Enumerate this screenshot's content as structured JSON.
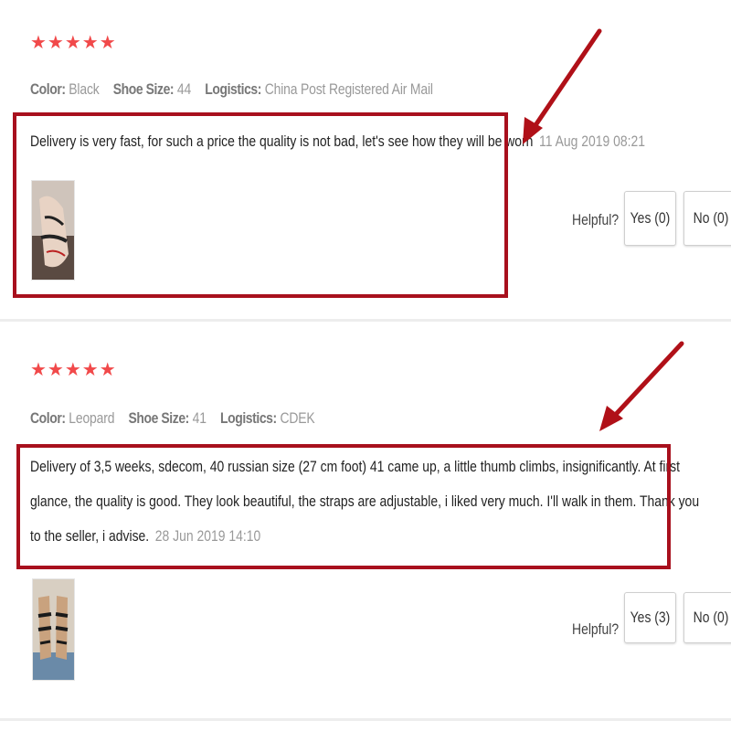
{
  "reviews": [
    {
      "stars": "★★★★★",
      "color_label": "Color:",
      "color_value": "Black",
      "size_label": "Shoe Size:",
      "size_value": "44",
      "logistics_label": "Logistics:",
      "logistics_value": "China Post Registered Air Mail",
      "text": "Delivery is very fast, for such a price the quality is not bad, let's see how they will be worn",
      "date": "11 Aug 2019 08:21",
      "helpful_label": "Helpful?",
      "yes_label": "Yes (0)",
      "no_label": "No (0)"
    },
    {
      "stars": "★★★★★",
      "color_label": "Color:",
      "color_value": "Leopard",
      "size_label": "Shoe Size:",
      "size_value": "41",
      "logistics_label": "Logistics:",
      "logistics_value": "CDEK",
      "text_line1": "Delivery of 3,5 weeks, sdecom, 40 russian size (27 cm foot) 41 came up, a little thumb climbs, insignificantly. At first",
      "text_line2": "glance, the quality is good. They look beautiful, the straps are adjustable, i liked very much. I'll walk in them. Thank you",
      "text_line3": "to the seller, i advise.",
      "date": "28 Jun 2019 14:10",
      "helpful_label": "Helpful?",
      "yes_label": "Yes (3)",
      "no_label": "No (0)"
    }
  ],
  "colors": {
    "accent_red": "#a8101d",
    "star_red": "#f1494a"
  }
}
